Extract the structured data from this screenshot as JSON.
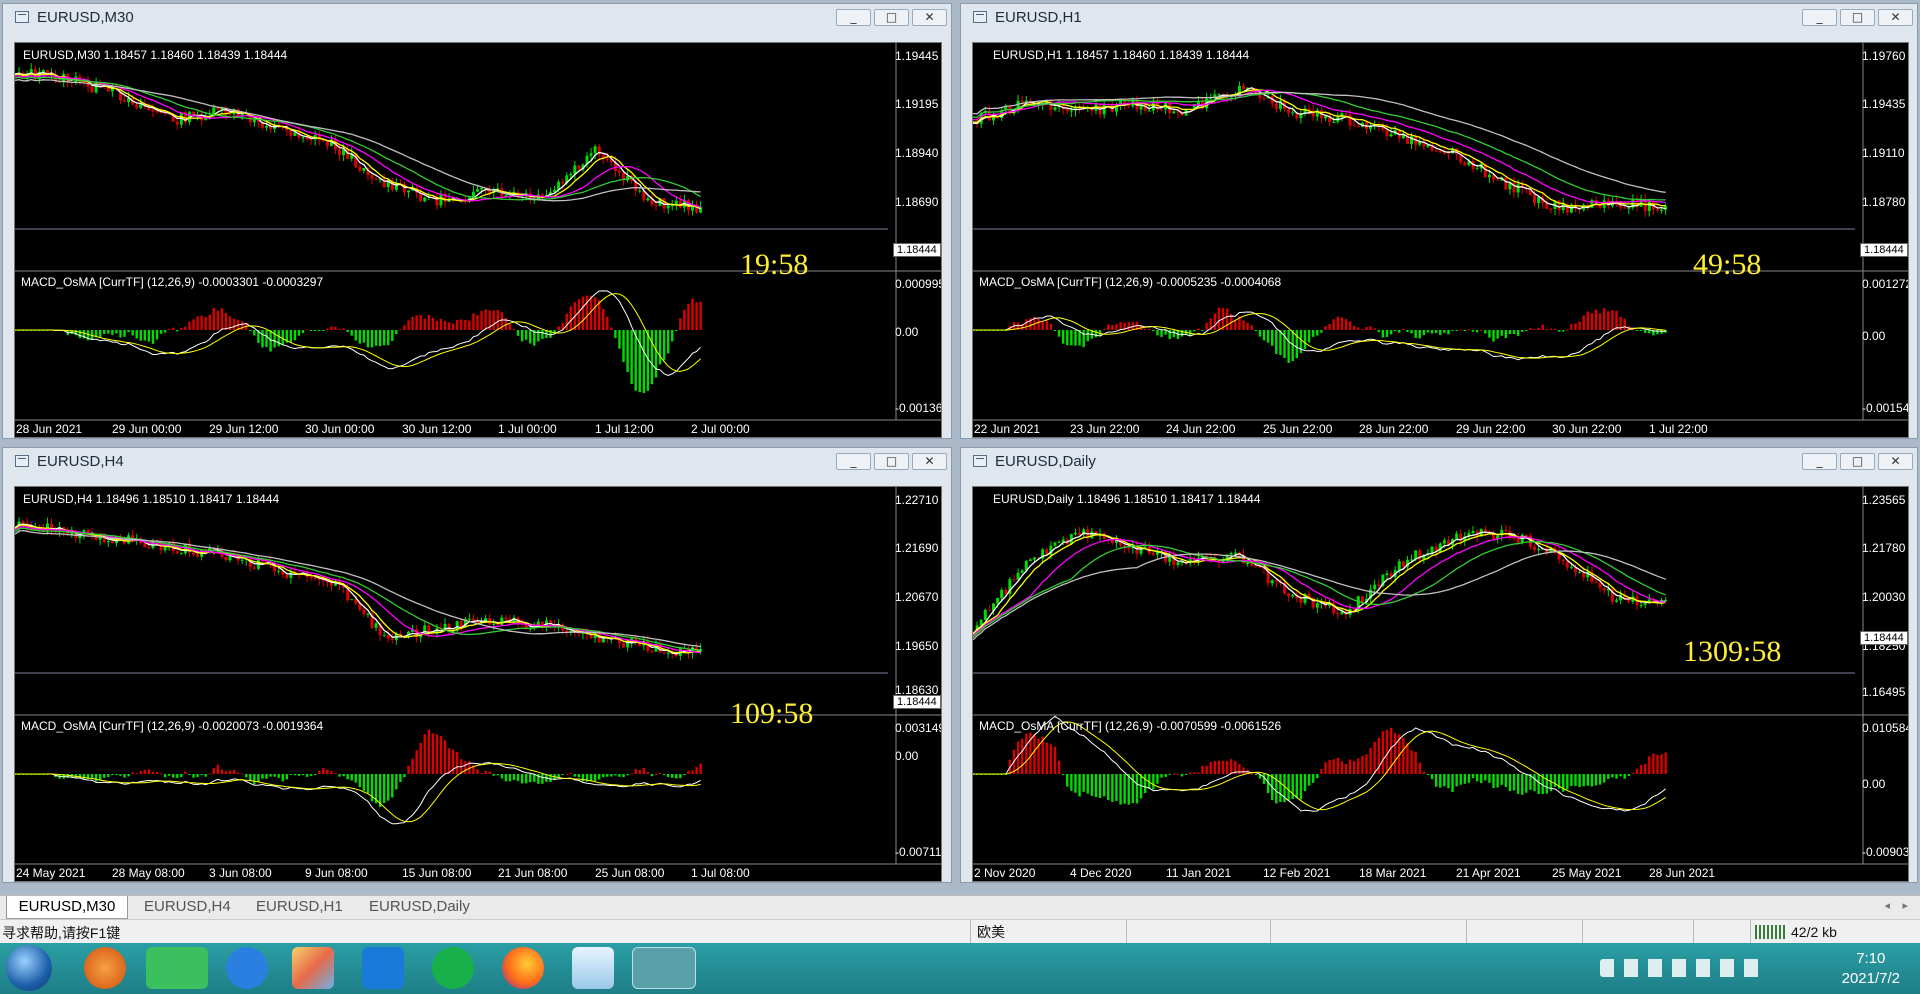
{
  "windows": [
    {
      "id": "m30",
      "title": "EURUSD,M30",
      "header": "EURUSD,M30  1.18457 1.18460 1.18439 1.18444",
      "price_ticks": [
        "1.19445",
        "1.19195",
        "1.18940",
        "1.18690"
      ],
      "current_price": "1.18444",
      "timer": "19:58",
      "macd_header": "MACD_OsMA [CurrTF] (12,26,9) -0.0003301 -0.0003297",
      "macd_ticks": [
        "0.0009954",
        "0.00",
        "-0.0013683"
      ],
      "time_ticks": [
        "28 Jun 2021",
        "29 Jun 00:00",
        "29 Jun 12:00",
        "30 Jun 00:00",
        "30 Jun 12:00",
        "1 Jul 00:00",
        "1 Jul 12:00",
        "2 Jul 00:00"
      ]
    },
    {
      "id": "h1",
      "title": "EURUSD,H1",
      "header": "EURUSD,H1  1.18457 1.18460 1.18439 1.18444",
      "price_ticks": [
        "1.19760",
        "1.19435",
        "1.19110",
        "1.18780"
      ],
      "current_price": "1.18444",
      "timer": "49:58",
      "macd_header": "MACD_OsMA [CurrTF] (12,26,9) -0.0005235 -0.0004068",
      "macd_ticks": [
        "0.0012724",
        "0.00",
        "-0.0015493"
      ],
      "time_ticks": [
        "22 Jun 2021",
        "23 Jun 22:00",
        "24 Jun 22:00",
        "25 Jun 22:00",
        "28 Jun 22:00",
        "29 Jun 22:00",
        "30 Jun 22:00",
        "1 Jul 22:00"
      ]
    },
    {
      "id": "h4",
      "title": "EURUSD,H4",
      "header": "EURUSD,H4  1.18496 1.18510 1.18417 1.18444",
      "price_ticks": [
        "1.22710",
        "1.21690",
        "1.20670",
        "1.19650",
        "1.18630"
      ],
      "current_price": "1.18444",
      "timer": "109:58",
      "macd_header": "MACD_OsMA [CurrTF] (12,26,9) -0.0020073 -0.0019364",
      "macd_ticks": [
        "0.0031496",
        "0.00",
        "-0.0071121"
      ],
      "time_ticks": [
        "24 May 2021",
        "28 May 08:00",
        "3 Jun 08:00",
        "9 Jun 08:00",
        "15 Jun 08:00",
        "21 Jun 08:00",
        "25 Jun 08:00",
        "1 Jul 08:00"
      ]
    },
    {
      "id": "d1",
      "title": "EURUSD,Daily",
      "header": "EURUSD,Daily  1.18496 1.18510 1.18417 1.18444",
      "price_ticks": [
        "1.23565",
        "1.21780",
        "1.20030",
        "1.18250",
        "1.16495"
      ],
      "current_price": "1.18444",
      "timer": "1309:58",
      "macd_header": "MACD_OsMA [CurrTF] (12,26,9) -0.0070599 -0.0061526",
      "macd_ticks": [
        "0.010584",
        "0.00",
        "-0.0090355"
      ],
      "time_ticks": [
        "2 Nov 2020",
        "4 Dec 2020",
        "11 Jan 2021",
        "12 Feb 2021",
        "18 Mar 2021",
        "21 Apr 2021",
        "25 May 2021",
        "28 Jun 2021"
      ]
    }
  ],
  "tabs": [
    "EURUSD,M30",
    "EURUSD,H4",
    "EURUSD,H1",
    "EURUSD,Daily"
  ],
  "active_tab": "EURUSD,M30",
  "status": {
    "help": "寻求帮助,请按F1键",
    "profile": "欧美",
    "traffic": "42/2 kb"
  },
  "clock": {
    "time": "7:10",
    "date": "2021/7/2"
  },
  "window_buttons": {
    "minimize": "_",
    "maximize": "□",
    "close": "✕"
  },
  "colors": {
    "bull": "#00dd00",
    "bear": "#dd0000",
    "ma_fast": "#ffffff",
    "ma_yellow": "#ffff00",
    "ma_magenta": "#ff00ff",
    "ma_green": "#33cc33",
    "ma_gray": "#c0c0c0"
  }
}
